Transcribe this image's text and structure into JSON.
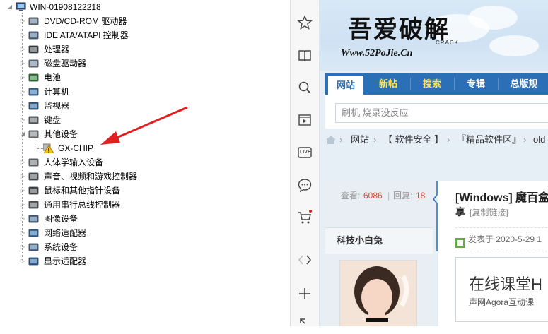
{
  "device_manager": {
    "computer_name": "WIN-01908122218",
    "nodes": [
      {
        "label": "DVD/CD-ROM 驱动器"
      },
      {
        "label": "IDE ATA/ATAPI 控制器"
      },
      {
        "label": "处理器"
      },
      {
        "label": "磁盘驱动器"
      },
      {
        "label": "电池"
      },
      {
        "label": "计算机"
      },
      {
        "label": "监视器"
      },
      {
        "label": "键盘"
      },
      {
        "label": "其他设备"
      },
      {
        "label": "GX-CHIP"
      },
      {
        "label": "人体学输入设备"
      },
      {
        "label": "声音、视频和游戏控制器"
      },
      {
        "label": "鼠标和其他指针设备"
      },
      {
        "label": "通用串行总线控制器"
      },
      {
        "label": "图像设备"
      },
      {
        "label": "网络适配器"
      },
      {
        "label": "系统设备"
      },
      {
        "label": "显示适配器"
      }
    ],
    "annotation_color": "#e02020"
  },
  "browser_rail": {
    "icons": [
      "star-icon",
      "book-icon",
      "search-icon",
      "video-icon",
      "live-icon",
      "chat-icon",
      "cart-icon",
      "arrows-icon",
      "plus-icon"
    ],
    "live_text": "LIVE"
  },
  "website": {
    "logo_title": "吾爱破解",
    "logo_url": "Www.52PoJie.Cn",
    "logo_crack": "CRACK",
    "nav": [
      "网站",
      "新帖",
      "搜索",
      "专辑",
      "总版规"
    ],
    "search_placeholder": "刷机 烧录没反应",
    "breadcrumbs": [
      "网站",
      "【 软件安全 】",
      "『精品软件区』",
      "old"
    ],
    "stats_view_label": "查看:",
    "stats_view_value": "6086",
    "stats_sep": "|",
    "stats_reply_label": "回复:",
    "stats_reply_value": "18",
    "author_name": "科技小白兔",
    "post_title": "[Windows] 魔百盒",
    "post_title_line2": "享",
    "copy_link": "[复制链接]",
    "post_meta": "发表于 2020-5-29 1",
    "ad_title": "在线课堂H",
    "ad_sub": "声网Agora互动课",
    "brand_color": "#2b6fb6",
    "accent_red": "#e04a2b"
  }
}
